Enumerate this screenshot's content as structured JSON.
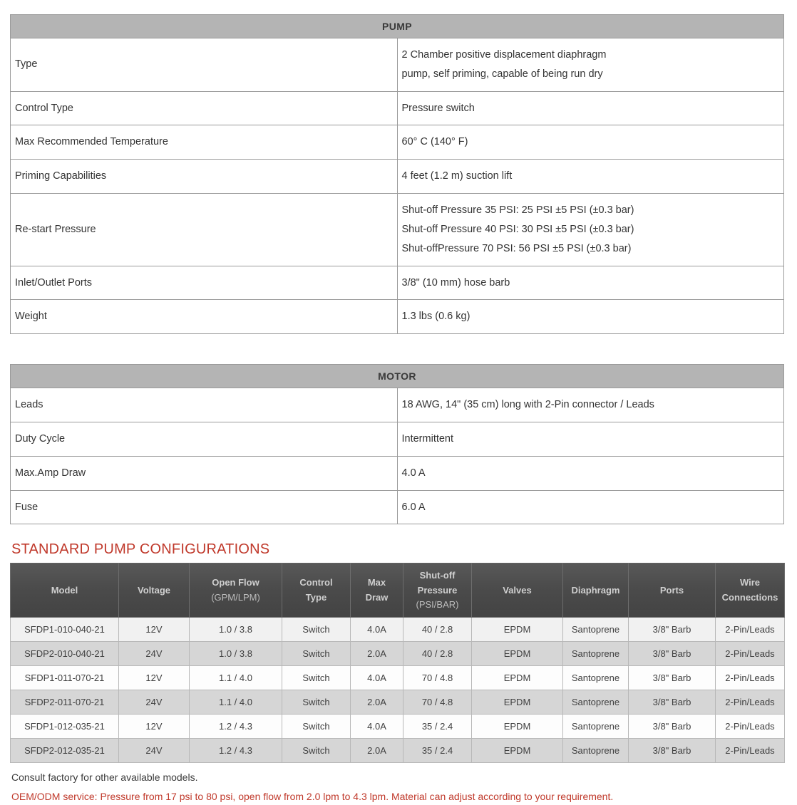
{
  "colors": {
    "banner_bg": "#b4b4b4",
    "config_header_bg": "#4b4b4b",
    "accent_red": "#c0392b",
    "row_light": "#f1f1f1",
    "row_dark": "#d6d6d6"
  },
  "pump_table": {
    "banner": "PUMP",
    "rows": [
      {
        "label": "Type",
        "lines": [
          "2 Chamber positive displacement diaphragm",
          "pump, self priming, capable of being run dry"
        ]
      },
      {
        "label": "Control Type",
        "lines": [
          "Pressure switch"
        ]
      },
      {
        "label": "Max Recommended Temperature",
        "label_lines": [
          "Max Recommended",
          "Temperature"
        ],
        "lines": [
          "60° C (140° F)"
        ]
      },
      {
        "label": "Priming Capabilities",
        "lines": [
          "4 feet (1.2 m) suction lift"
        ]
      },
      {
        "label": "Re-start Pressure",
        "lines": [
          "Shut-off Pressure 35 PSI: 25 PSI ±5 PSI (±0.3 bar)",
          "Shut-off Pressure 40 PSI: 30 PSI ±5 PSI (±0.3 bar)",
          "Shut-offPressure 70 PSI: 56 PSI ±5 PSI (±0.3 bar)"
        ]
      },
      {
        "label": "Inlet/Outlet Ports",
        "lines": [
          "3/8\" (10 mm) hose barb"
        ]
      },
      {
        "label": "Weight",
        "lines": [
          "1.3 lbs (0.6 kg)"
        ]
      }
    ]
  },
  "motor_table": {
    "banner": "MOTOR",
    "rows": [
      {
        "label": "Leads",
        "lines": [
          "18 AWG, 14\" (35 cm) long with 2-Pin connector / Leads"
        ]
      },
      {
        "label": "Duty Cycle",
        "lines": [
          "Intermittent"
        ]
      },
      {
        "label": "Max.Amp Draw",
        "lines": [
          "4.0 A"
        ]
      },
      {
        "label": "Fuse",
        "lines": [
          "6.0 A"
        ]
      }
    ]
  },
  "config_section": {
    "heading": "STANDARD PUMP CONFIGURATIONS",
    "headers": [
      {
        "main": "Model",
        "sub": ""
      },
      {
        "main": "Voltage",
        "sub": ""
      },
      {
        "main": "Open Flow",
        "sub": "(GPM/LPM)"
      },
      {
        "main": "Control Type",
        "main_lines": [
          "Control",
          "Type"
        ],
        "sub": ""
      },
      {
        "main": "Max Draw",
        "main_lines": [
          "Max",
          "Draw"
        ],
        "sub": ""
      },
      {
        "main": "Shut-off Pressure",
        "main_lines": [
          "Shut-off",
          "Pressure"
        ],
        "sub": "(PSI/BAR)"
      },
      {
        "main": "Valves",
        "sub": ""
      },
      {
        "main": "Diaphragm",
        "sub": ""
      },
      {
        "main": "Ports",
        "sub": ""
      },
      {
        "main": "Wire Connections",
        "main_lines": [
          "Wire",
          "Connections"
        ],
        "sub": ""
      }
    ],
    "rows": [
      [
        "SFDP1-010-040-21",
        "12V",
        "1.0 / 3.8",
        "Switch",
        "4.0A",
        "40 / 2.8",
        "EPDM",
        "Santoprene",
        "3/8\" Barb",
        "2-Pin/Leads"
      ],
      [
        "SFDP2-010-040-21",
        "24V",
        "1.0 / 3.8",
        "Switch",
        "2.0A",
        "40 / 2.8",
        "EPDM",
        "Santoprene",
        "3/8\" Barb",
        "2-Pin/Leads"
      ],
      [
        "SFDP1-011-070-21",
        "12V",
        "1.1 / 4.0",
        "Switch",
        "4.0A",
        "70 / 4.8",
        "EPDM",
        "Santoprene",
        "3/8\" Barb",
        "2-Pin/Leads"
      ],
      [
        "SFDP2-011-070-21",
        "24V",
        "1.1 / 4.0",
        "Switch",
        "2.0A",
        "70 / 4.8",
        "EPDM",
        "Santoprene",
        "3/8\" Barb",
        "2-Pin/Leads"
      ],
      [
        "SFDP1-012-035-21",
        "12V",
        "1.2 / 4.3",
        "Switch",
        "4.0A",
        "35 / 2.4",
        "EPDM",
        "Santoprene",
        "3/8\" Barb",
        "2-Pin/Leads"
      ],
      [
        "SFDP2-012-035-21",
        "24V",
        "1.2 / 4.3",
        "Switch",
        "2.0A",
        "35 / 2.4",
        "EPDM",
        "Santoprene",
        "3/8\" Barb",
        "2-Pin/Leads"
      ]
    ]
  },
  "notes": {
    "plain": "Consult factory for other available models.",
    "red": "OEM/ODM service: Pressure from 17 psi to 80 psi, open flow from 2.0 lpm to 4.3 lpm. Material can adjust according to your requirement."
  }
}
